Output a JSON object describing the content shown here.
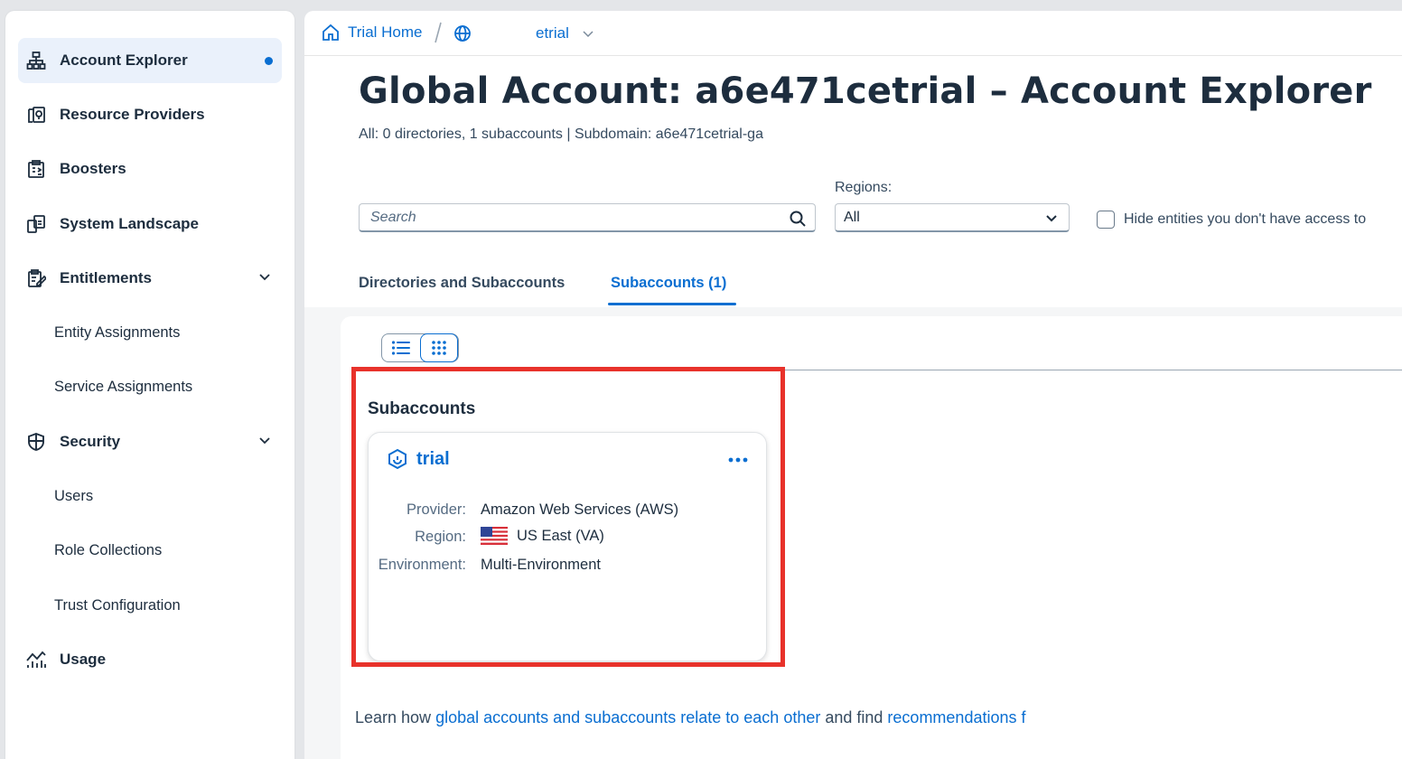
{
  "sidebar": {
    "items": [
      {
        "label": "Account Explorer",
        "icon": "hierarchy-icon",
        "selected": true
      },
      {
        "label": "Resource Providers",
        "icon": "resource-providers-icon"
      },
      {
        "label": "Boosters",
        "icon": "boosters-icon"
      },
      {
        "label": "System Landscape",
        "icon": "system-landscape-icon"
      },
      {
        "label": "Entitlements",
        "icon": "entitlements-icon",
        "expanded": true
      },
      {
        "label": "Entity Assignments",
        "sub": true
      },
      {
        "label": "Service Assignments",
        "sub": true
      },
      {
        "label": "Security",
        "icon": "security-icon",
        "expanded": true
      },
      {
        "label": "Users",
        "sub": true
      },
      {
        "label": "Role Collections",
        "sub": true
      },
      {
        "label": "Trust Configuration",
        "sub": true
      },
      {
        "label": "Usage",
        "icon": "usage-icon"
      }
    ]
  },
  "breadcrumb": {
    "home": "Trial Home",
    "account": "etrial"
  },
  "page": {
    "title": "Global Account: a6e471cetrial – Account Explorer",
    "subtitle": "All: 0 directories, 1 subaccounts | Subdomain: a6e471cetrial-ga"
  },
  "filters": {
    "search_placeholder": "Search",
    "regions_label": "Regions:",
    "regions_value": "All",
    "hide_entities_label": "Hide entities you don't have access to"
  },
  "tabs": [
    {
      "label": "Directories and Subaccounts",
      "active": false
    },
    {
      "label": "Subaccounts (1)",
      "active": true
    }
  ],
  "section": {
    "title": "Subaccounts"
  },
  "card": {
    "name": "trial",
    "provider_label": "Provider:",
    "provider_value": "Amazon Web Services (AWS)",
    "region_label": "Region:",
    "region_value": "US East (VA)",
    "environment_label": "Environment:",
    "environment_value": "Multi-Environment"
  },
  "footer": {
    "prefix": "Learn how ",
    "link1": "global accounts and subaccounts relate to each other",
    "middle": " and find ",
    "link2": "recommendations f"
  },
  "colors": {
    "accent": "#0a6ed1",
    "highlight": "#e8322b",
    "selected_bg": "#eaf1fb"
  }
}
